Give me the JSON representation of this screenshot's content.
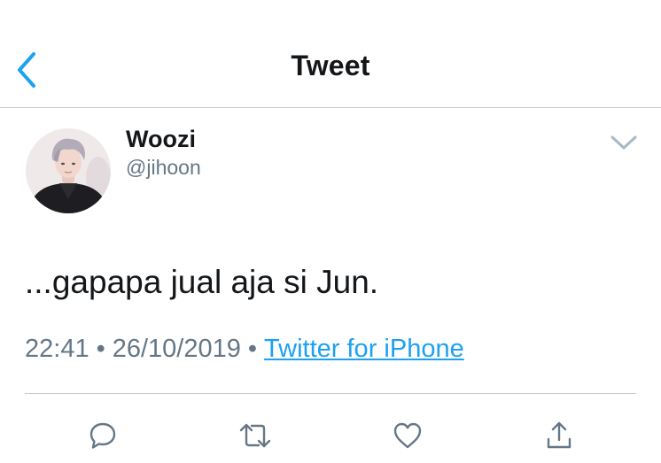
{
  "nav": {
    "title": "Tweet",
    "back_icon": "chevron-left-icon"
  },
  "tweet": {
    "author": {
      "display_name": "Woozi",
      "handle": "@jihoon",
      "avatar_icon": "avatar"
    },
    "text": "...gapapa jual aja si Jun.",
    "time": "22:41",
    "date": "26/10/2019",
    "separator": "•",
    "source": "Twitter for iPhone",
    "menu_icon": "chevron-down-icon"
  },
  "actions": [
    "reply-icon",
    "retweet-icon",
    "like-icon",
    "share-icon"
  ],
  "colors": {
    "accent": "#1da1f2",
    "text": "#14171a",
    "secondary": "#657786",
    "divider": "#c8ccd0"
  }
}
